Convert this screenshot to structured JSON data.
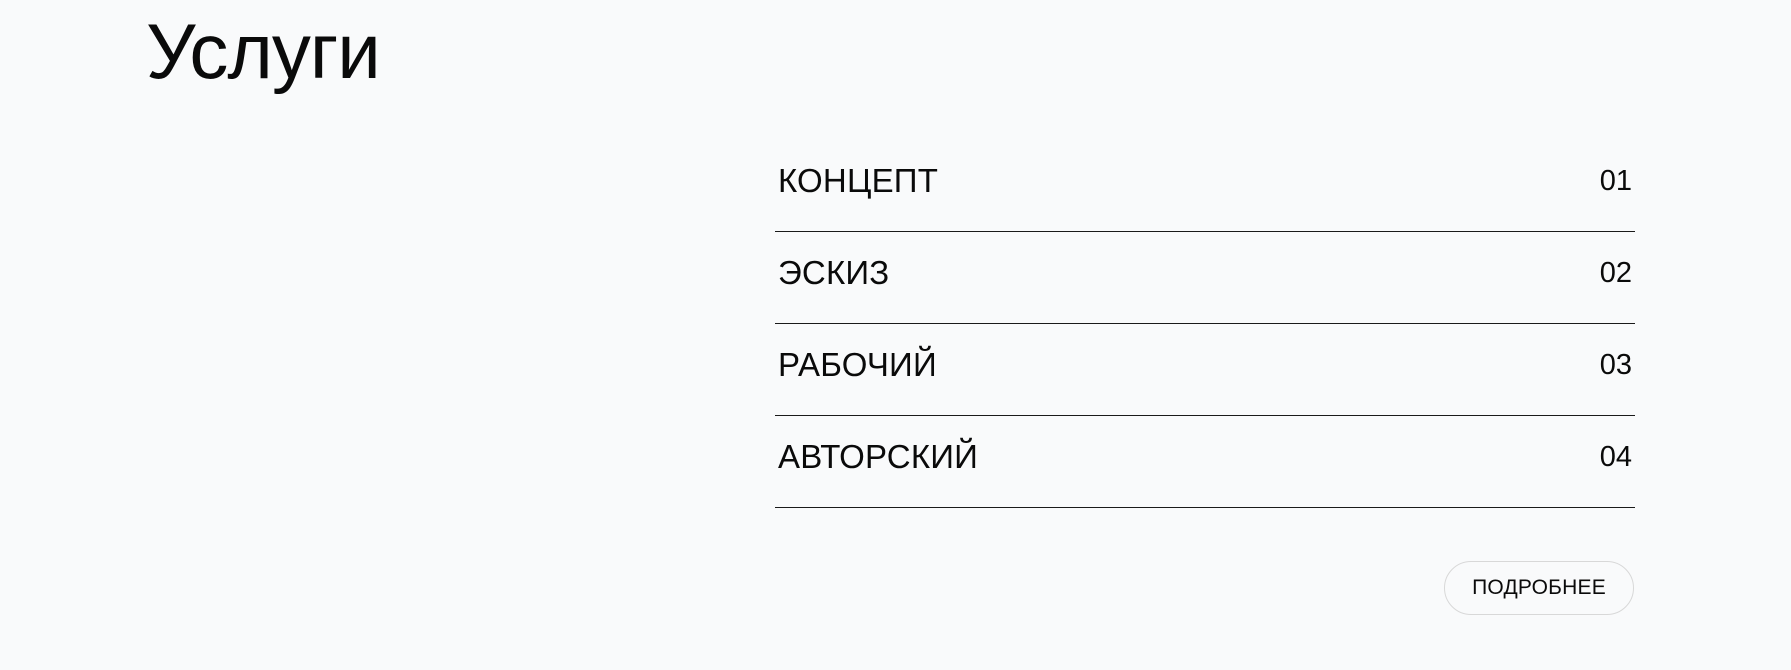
{
  "page": {
    "title": "Услуги"
  },
  "services": [
    {
      "label": "КОНЦЕПТ",
      "number": "01"
    },
    {
      "label": "ЭСКИЗ",
      "number": "02"
    },
    {
      "label": "РАБОЧИЙ",
      "number": "03"
    },
    {
      "label": "АВТОРСКИЙ",
      "number": "04"
    }
  ],
  "actions": {
    "more_label": "ПОДРОБНЕЕ"
  },
  "colors": {
    "background": "#f9fafb",
    "text": "#0a0a0a",
    "divider": "#1a1a1a",
    "button_border": "#d8d8d8"
  }
}
